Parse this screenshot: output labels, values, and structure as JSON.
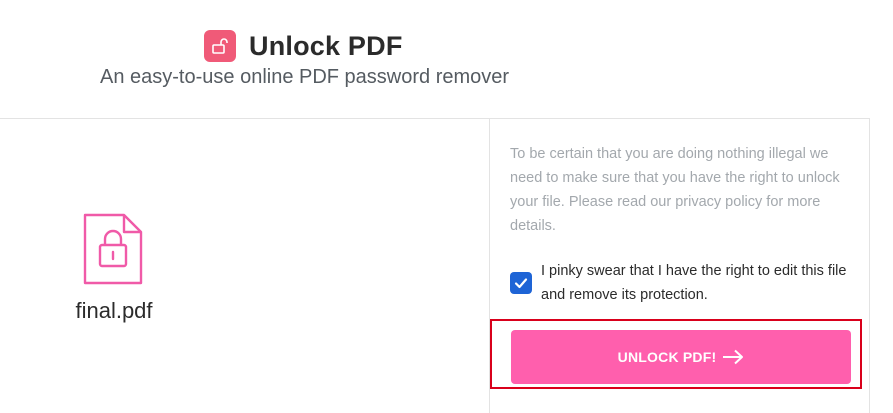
{
  "header": {
    "title": "Unlock PDF",
    "subtitle": "An easy-to-use online PDF password remover",
    "icon": "unlock-icon"
  },
  "file": {
    "name": "final.pdf",
    "icon": "locked-file-icon"
  },
  "panel": {
    "notice": "To be certain that you are doing nothing illegal we need to make sure that you have the right to unlock your file. Please read our privacy policy for more details.",
    "consent_label": "I pinky swear that I have the right to edit this file and remove its protection.",
    "consent_checked": true,
    "button_label": "UNLOCK PDF!",
    "button_icon": "arrow-right-icon"
  },
  "colors": {
    "accent": "#f05a78",
    "button": "#ff5fad",
    "checkbox": "#1e64d6",
    "highlight_border": "#d9001b"
  }
}
